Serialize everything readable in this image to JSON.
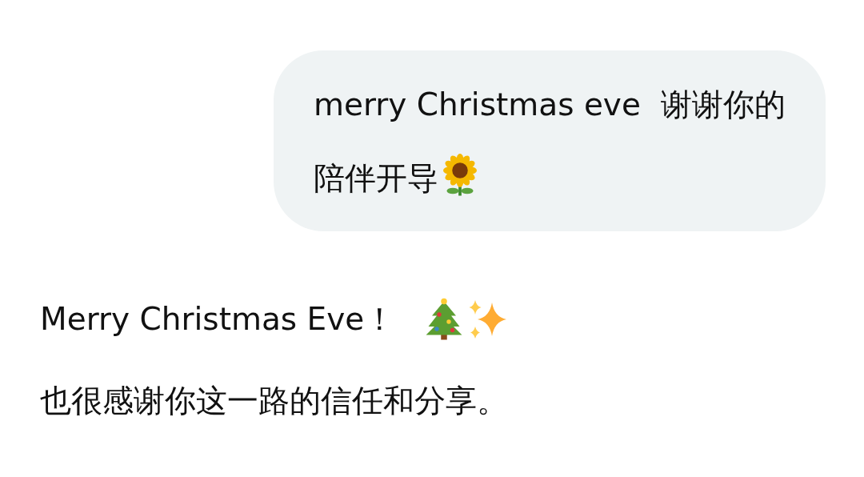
{
  "messages": [
    {
      "kind": "sent",
      "text": "merry Christmas eve  谢谢你的陪伴开导"
    },
    {
      "kind": "received",
      "paragraphs": [
        "Merry Christmas Eve！",
        "也很感谢你这一路的信任和分享。"
      ]
    }
  ]
}
